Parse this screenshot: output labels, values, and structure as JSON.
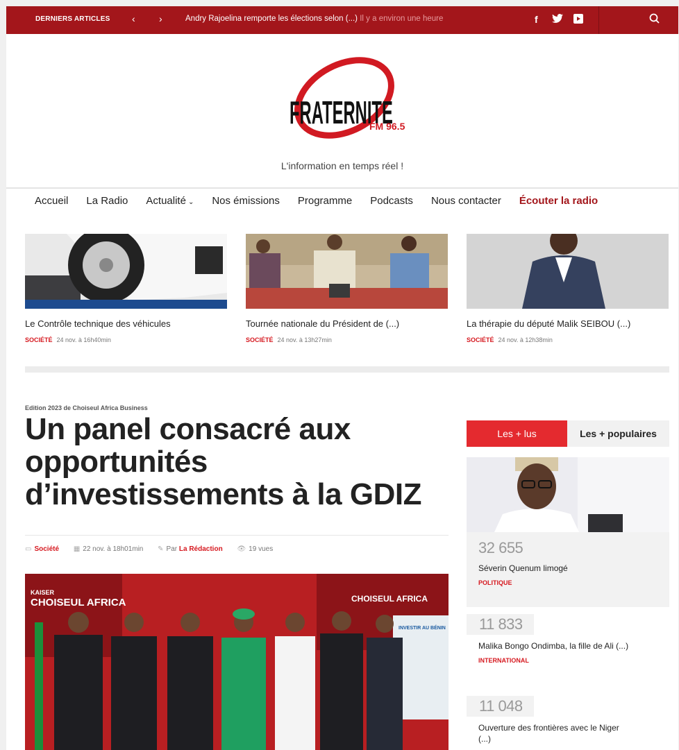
{
  "topbar": {
    "latest_label": "DERNIERS ARTICLES",
    "prev_icon": "chevron-left-icon",
    "next_icon": "chevron-right-icon",
    "ticker_text": "Andry Rajoelina remporte les élections selon (...)",
    "ticker_time": "Il y a environ une heure",
    "social": {
      "facebook": "f",
      "twitter": "twitter-icon",
      "youtube": "youtube-icon"
    },
    "search_icon": "search-icon",
    "bg_color": "#a3161b"
  },
  "header": {
    "logo_main": "FRATERNITE",
    "logo_sub": "FM 96.5",
    "tagline": "L'information en temps réel !"
  },
  "menu": {
    "items": [
      "Accueil",
      "La Radio",
      "Actualité",
      "Nos émissions",
      "Programme",
      "Podcasts",
      "Nous contacter"
    ],
    "listen": "Écouter la radio",
    "dropdown_icon": "chevron-down-icon"
  },
  "cards": [
    {
      "title": "Le Contrôle technique des véhicules",
      "category": "SOCIÉTÉ",
      "date": "24 nov. à 16h40min"
    },
    {
      "title": "Tournée nationale du Président de (...)",
      "category": "SOCIÉTÉ",
      "date": "24 nov. à 13h27min"
    },
    {
      "title": "La thérapie du député Malik SEIBOU (...)",
      "category": "SOCIÉTÉ",
      "date": "24 nov. à 12h38min"
    }
  ],
  "article": {
    "kicker": "Edition 2023 de Choiseul Africa Business",
    "headline": "Un panel consacré aux opportunités d’investissements à la GDIZ",
    "category": "Société",
    "date": "22 nov. à 18h01min",
    "by_label": "Par",
    "author": "La Rédaction",
    "views": "19 vues",
    "banner_left": "CHOISEUL AFRICA",
    "banner_right": "CHOISEUL AFRICA",
    "banner_kicker": "KAISER",
    "poster": "INVESTIR AU BÉNIN"
  },
  "sidebar": {
    "tab_active": "Les + lus",
    "tab_other": "Les + populaires",
    "accent": "#e42a2f",
    "items": [
      {
        "count": "32 655",
        "title": "Séverin Quenum limogé",
        "category": "POLITIQUE"
      },
      {
        "count": "11 833",
        "title": "Malika Bongo Ondimba, la fille de Ali (...)",
        "category": "INTERNATIONAL"
      },
      {
        "count": "11 048",
        "title": "Ouverture des frontières avec le Niger (...)",
        "category": ""
      }
    ]
  }
}
